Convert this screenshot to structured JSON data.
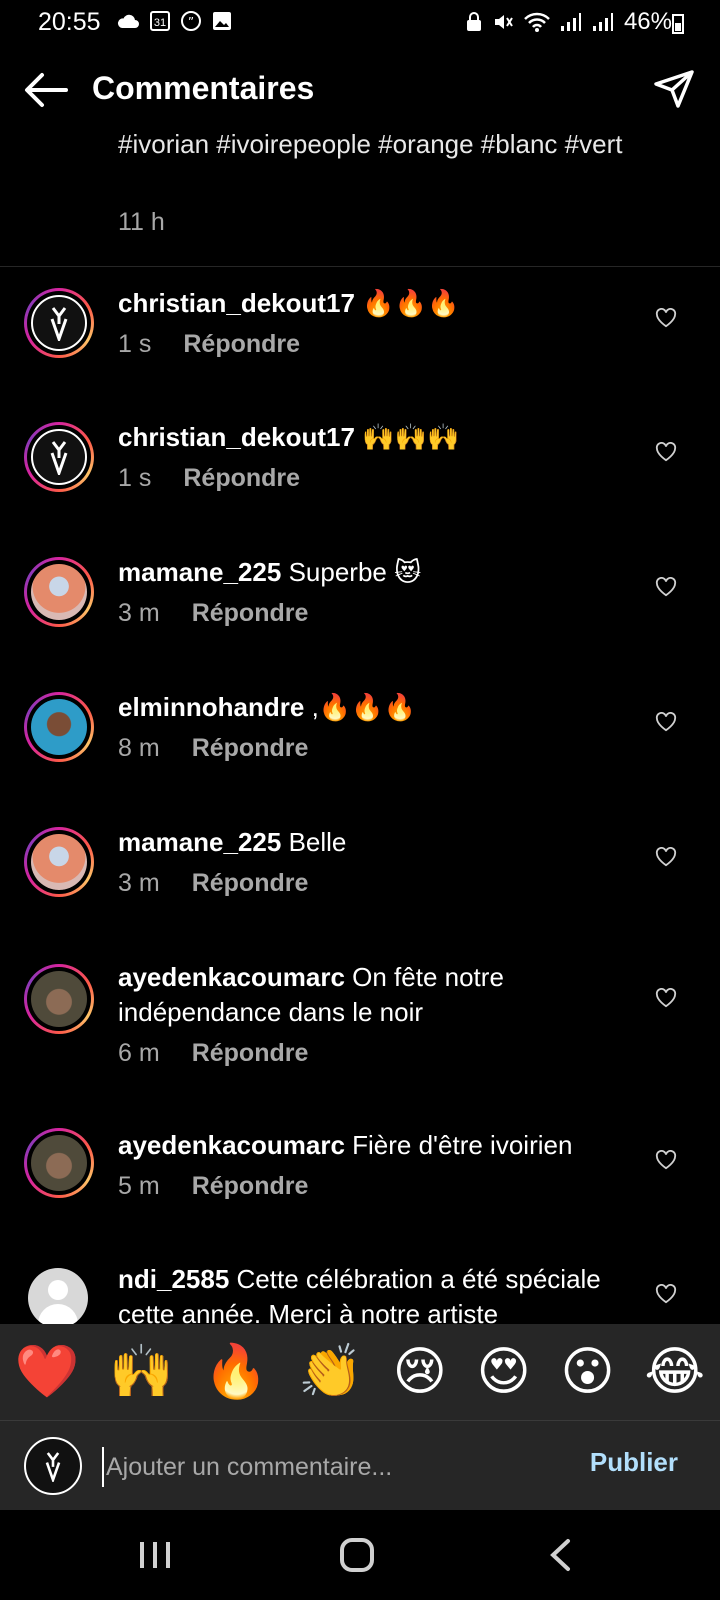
{
  "status_bar": {
    "time": "20:55",
    "battery": "46%",
    "calendar_day": "31"
  },
  "header": {
    "title": "Commentaires"
  },
  "caption": {
    "text": "#ivorian #ivoirepeople #orange #blanc #vert",
    "time": "11 h"
  },
  "comments": [
    {
      "user": "christian_dekout17",
      "text": "🔥🔥🔥",
      "time": "1 s",
      "reply": "Répondre"
    },
    {
      "user": "christian_dekout17",
      "text": "🙌🙌🙌",
      "time": "1 s",
      "reply": "Répondre"
    },
    {
      "user": "mamane_225",
      "text": "Superbe 😻",
      "time": "3 m",
      "reply": "Répondre"
    },
    {
      "user": "elminnohandre",
      "text": ",🔥🔥🔥",
      "time": "8 m",
      "reply": "Répondre"
    },
    {
      "user": "mamane_225",
      "text": "Belle",
      "time": "3 m",
      "reply": "Répondre"
    },
    {
      "user": "ayedenkacoumarc",
      "text": "On fête notre indépendance dans le noir",
      "time": "6 m",
      "reply": "Répondre"
    },
    {
      "user": "ayedenkacoumarc",
      "text": "Fière d'être ivoirien",
      "time": "5 m",
      "reply": "Répondre"
    },
    {
      "user": "ndi_2585",
      "text": "Cette célébration a été spéciale cette année. Merci à notre artiste",
      "time": "",
      "reply": ""
    }
  ],
  "emoji_bar": [
    "❤️",
    "🙌",
    "🔥",
    "👏",
    "😢",
    "😍",
    "😮",
    "😂"
  ],
  "input": {
    "placeholder": "Ajouter un commentaire...",
    "publish_label": "Publier"
  },
  "colors": {
    "background": "#000000",
    "panel": "#262626",
    "muted": "#a8a8a8",
    "publish": "#b2dffc"
  }
}
